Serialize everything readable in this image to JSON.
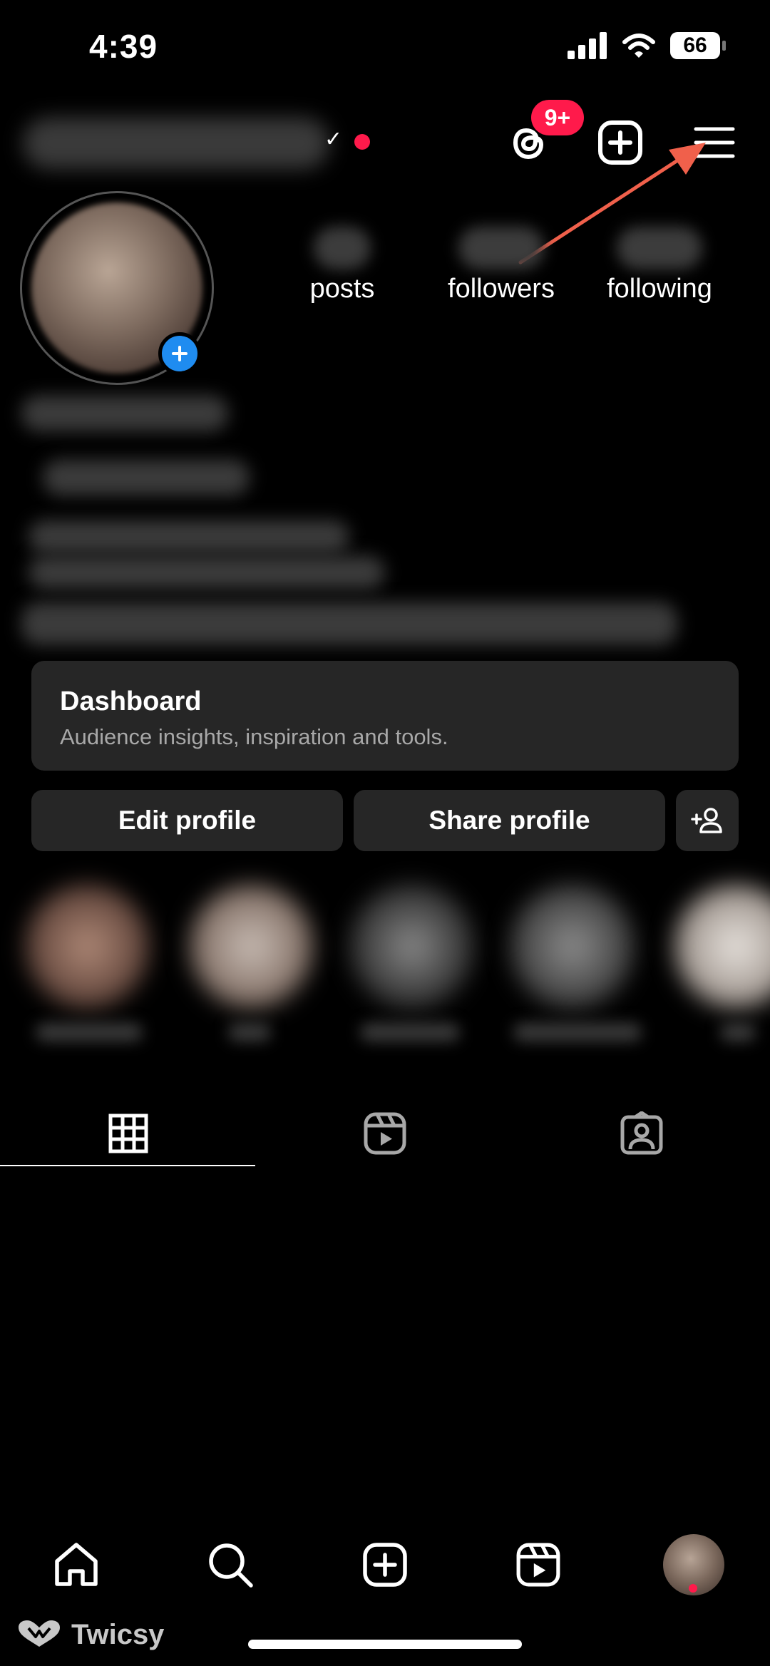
{
  "status_bar": {
    "time": "4:39",
    "battery": "66"
  },
  "header": {
    "notification_badge": "9+"
  },
  "profile": {
    "stats": [
      {
        "label": "posts"
      },
      {
        "label": "followers"
      },
      {
        "label": "following"
      }
    ]
  },
  "dashboard": {
    "title": "Dashboard",
    "subtitle": "Audience insights, inspiration and tools."
  },
  "actions": {
    "edit_label": "Edit profile",
    "share_label": "Share profile"
  },
  "branding": {
    "name": "Twicsy"
  },
  "colors": {
    "accent_red": "#ff1a4b",
    "blue": "#1f8cf0",
    "annotation_arrow": "#f0604b"
  }
}
